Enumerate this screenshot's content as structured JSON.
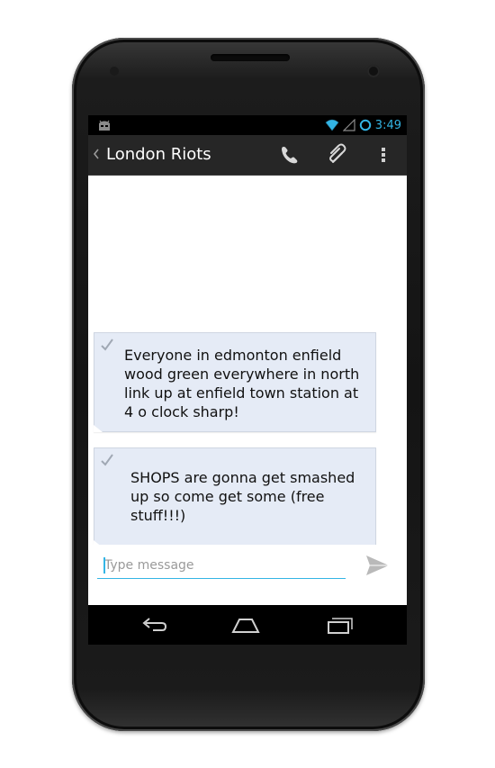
{
  "status_bar": {
    "time": "3:49"
  },
  "action_bar": {
    "title": "London Riots"
  },
  "messages": [
    {
      "text": "Everyone in edmonton enfield wood green everywhere in north link up at enfield town station at 4 o clock sharp!"
    },
    {
      "text": "SHOPS are gonna get smashed up so come get some (free stuff!!!)"
    }
  ],
  "compose": {
    "placeholder": "Type message",
    "value": ""
  },
  "colors": {
    "accent": "#33b5e5",
    "bubble": "#e5ebf6",
    "action_bar": "#262626"
  }
}
